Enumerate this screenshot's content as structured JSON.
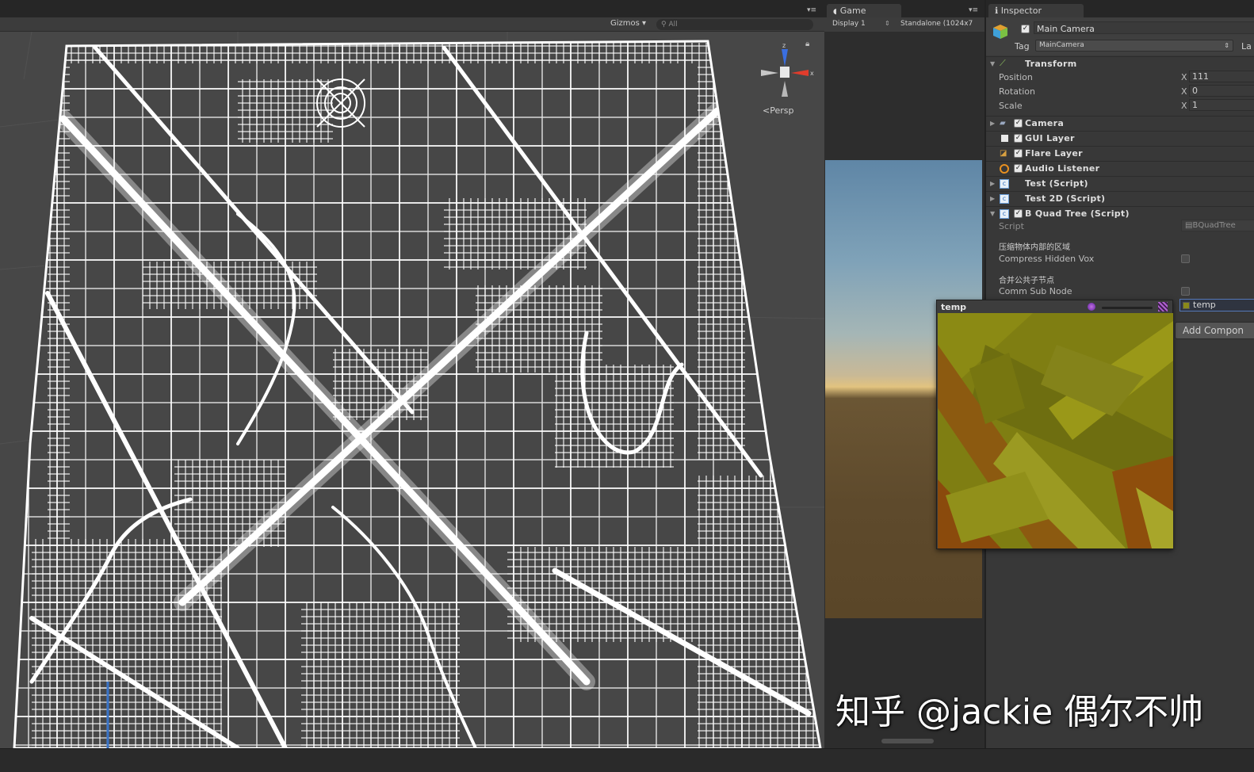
{
  "scene": {
    "gizmos_label": "Gizmos ▾",
    "search_placeholder": "All",
    "persp_label": "Persp",
    "gizmo_axes": {
      "z": "z",
      "x": "x"
    }
  },
  "game": {
    "tab_label": "Game",
    "display_label": "Display 1",
    "resolution_label": "Standalone (1024x7"
  },
  "inspector": {
    "tab_label": "Inspector",
    "object_name": "Main Camera",
    "active": true,
    "tag_label": "Tag",
    "tag_value": "MainCamera",
    "layer_label": "La",
    "transform": {
      "title": "Transform",
      "position_label": "Position",
      "position_x_axis": "X",
      "position_x": "111",
      "rotation_label": "Rotation",
      "rotation_x_axis": "X",
      "rotation_x": "0",
      "scale_label": "Scale",
      "scale_x_axis": "X",
      "scale_x": "1"
    },
    "components": [
      {
        "label": "Camera",
        "enabled": true
      },
      {
        "label": "GUI Layer",
        "enabled": true
      },
      {
        "label": "Flare Layer",
        "enabled": true
      },
      {
        "label": "Audio Listener",
        "enabled": true
      },
      {
        "label": "Test (Script)"
      },
      {
        "label": "Test 2D (Script)"
      },
      {
        "label": "B Quad Tree (Script)",
        "enabled": true
      }
    ],
    "quadtree": {
      "script_label": "Script",
      "script_value": "BQuadTree",
      "compress_cn": "压缩物体内部的区域",
      "compress_label": "Compress Hidden Vox",
      "compress_value": false,
      "comm_cn": "合并公共子节点",
      "comm_label": "Comm Sub Node",
      "comm_value": false,
      "texture_value": "temp"
    },
    "add_component_label": "Add Compon"
  },
  "temp_preview": {
    "title": "temp"
  },
  "watermark": "知乎 @jackie 偶尔不帅",
  "colors": {
    "scene_bg": "#474747",
    "wire": "#ffffff",
    "inspector_bg": "#383838",
    "texture_yellow": "#8a8a10"
  }
}
